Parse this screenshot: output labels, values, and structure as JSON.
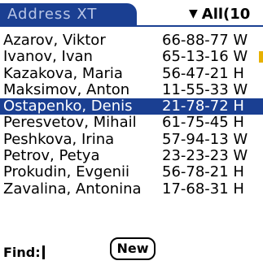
{
  "app": {
    "title": "Address XT",
    "category": "All(10"
  },
  "contacts": [
    {
      "name": "Azarov, Viktor",
      "phone": "66-88-77 W",
      "selected": false
    },
    {
      "name": "Ivanov, Ivan",
      "phone": "65-13-16 W",
      "selected": false
    },
    {
      "name": "Kazakova, Maria",
      "phone": "56-47-21 H",
      "selected": false
    },
    {
      "name": "Maksimov, Anton",
      "phone": "11-55-33 W",
      "selected": false
    },
    {
      "name": "Ostapenko, Denis",
      "phone": "21-78-72 H",
      "selected": true
    },
    {
      "name": "Peresvetov, Mihail",
      "phone": "61-75-45 H",
      "selected": false
    },
    {
      "name": "Peshkova, Irina",
      "phone": "57-94-13 W",
      "selected": false
    },
    {
      "name": "Petrov, Petya",
      "phone": "23-23-23 W",
      "selected": false
    },
    {
      "name": "Prokudin, Evgenii",
      "phone": "56-78-21 H",
      "selected": false
    },
    {
      "name": "Zavalina, Antonina",
      "phone": "17-68-31 H",
      "selected": false
    }
  ],
  "footer": {
    "find_label": "Find:",
    "new_button": "New"
  },
  "colors": {
    "accent": "#1a3f92",
    "scroll_indicator": "#e7b100"
  },
  "icons": {
    "category_dropdown": "triangle-down-icon"
  }
}
